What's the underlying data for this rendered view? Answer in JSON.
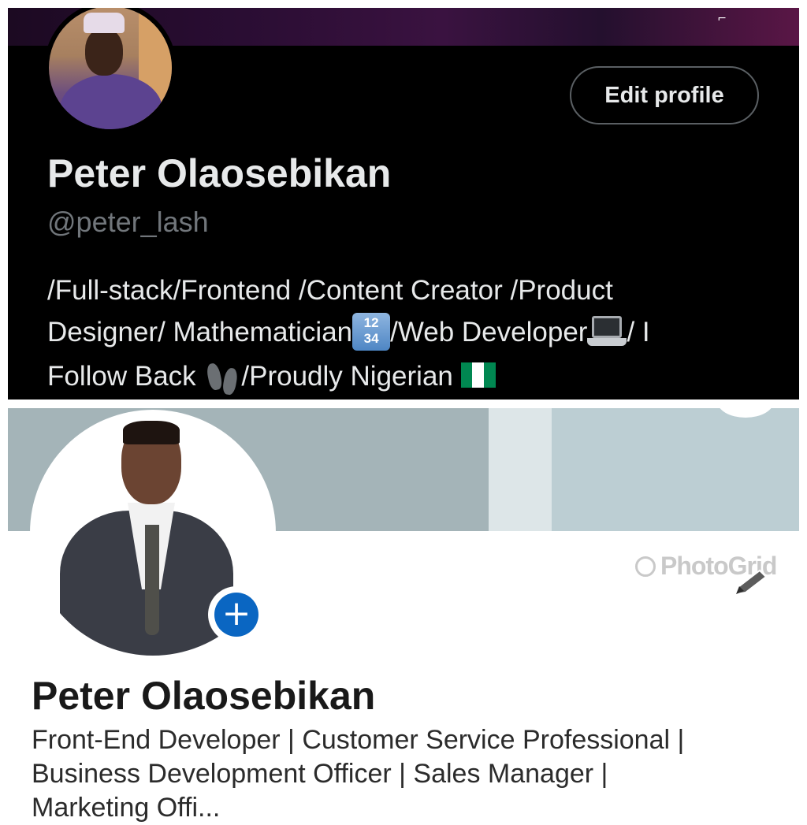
{
  "twitter": {
    "edit_profile_label": "Edit profile",
    "name": "Peter Olaosebikan",
    "handle": "@peter_lash",
    "bio": {
      "line1": "/Full-stack/Frontend /Content Creator /Product",
      "line2_a": "Designer/ Mathematician",
      "numbers_emoji_top": "12",
      "numbers_emoji_bottom": "34",
      "line2_b": "/Web Developer",
      "line2_c": "/ I",
      "line3_a": "Follow Back ",
      "line3_b": "/Proudly Nigerian "
    },
    "colors": {
      "background": "#000000",
      "text": "#e7e9ea",
      "muted": "#71767b"
    }
  },
  "linkedin": {
    "name": "Peter Olaosebikan",
    "headline": {
      "line1": "Front-End Developer | Customer Service Professional |",
      "line2": "Business Development Officer | Sales Manager |",
      "line3": "Marketing Offi..."
    },
    "add_icon": "plus-icon",
    "colors": {
      "accent": "#0a66c2",
      "banner": "#a4b4b8"
    }
  },
  "watermark": {
    "text": "PhotoGrid"
  }
}
